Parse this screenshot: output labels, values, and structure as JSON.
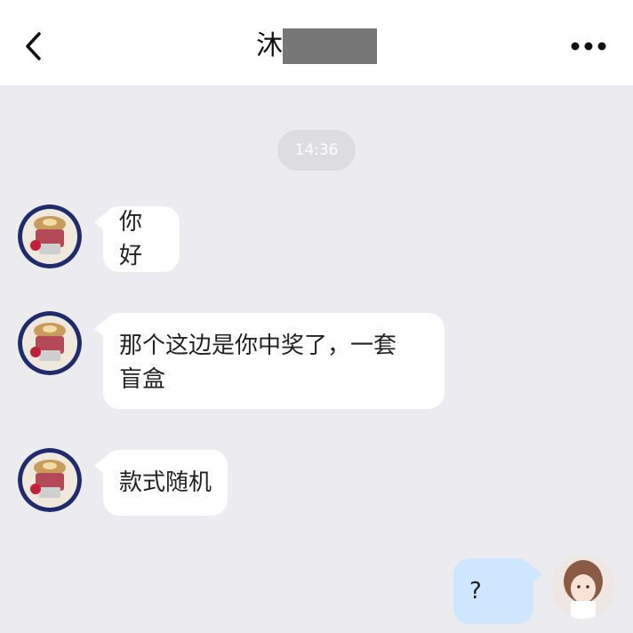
{
  "header": {
    "back_icon": "chevron-left-icon",
    "title_visible": "沐",
    "more_icon": "more-horizontal-icon"
  },
  "chat": {
    "timestamp": "14:36",
    "messages": [
      {
        "side": "incoming",
        "text": "你好"
      },
      {
        "side": "incoming",
        "lines": [
          "那个这边是你中奖了，一套",
          "盲盒"
        ]
      },
      {
        "side": "incoming",
        "text": "款式随机"
      },
      {
        "side": "outgoing",
        "text": "?"
      }
    ]
  },
  "colors": {
    "background": "#ebebf0",
    "header": "#ffffff",
    "incoming_bubble": "#ffffff",
    "outgoing_bubble": "#cfe6ff",
    "timestamp_pill": "#dcdce1"
  }
}
